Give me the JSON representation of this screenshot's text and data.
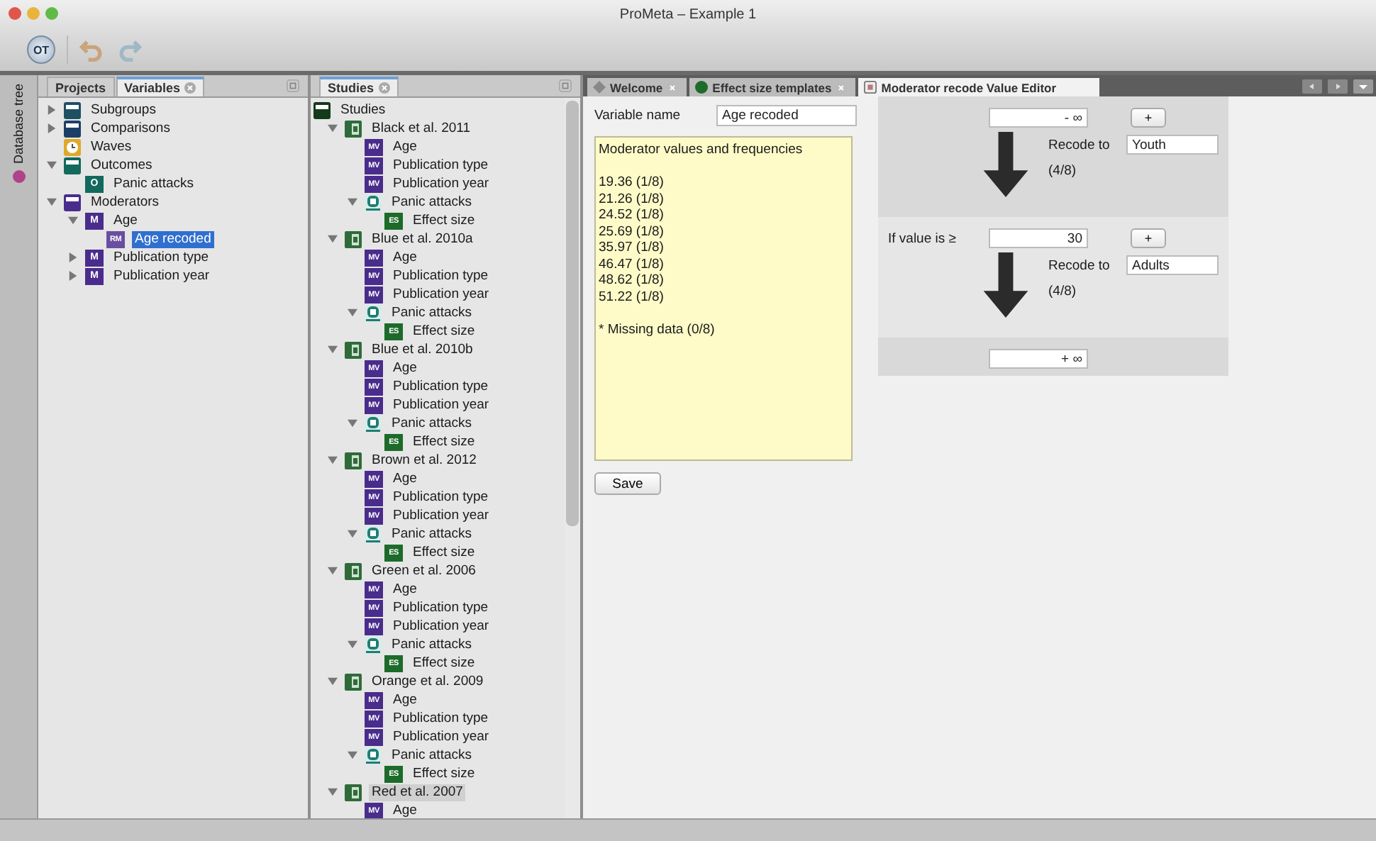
{
  "window": {
    "title": "ProMeta – Example 1"
  },
  "toolbar": {
    "logo": "OT"
  },
  "side_tab": {
    "label": "Database tree"
  },
  "variables_panel": {
    "tabs": [
      {
        "label": "Projects",
        "selected": false,
        "closable": false
      },
      {
        "label": "Variables",
        "selected": true,
        "closable": true
      }
    ],
    "items": [
      {
        "label": "Subgroups",
        "kind": "folder",
        "color": "#1f4f63",
        "expanded": false,
        "selected": false
      },
      {
        "label": "Comparisons",
        "kind": "folder",
        "color": "#1d3f66",
        "expanded": false,
        "selected": false
      },
      {
        "label": "Waves",
        "kind": "clock",
        "selected": false
      },
      {
        "label": "Outcomes",
        "kind": "folder",
        "color": "#12695c",
        "expanded": true,
        "selected": false,
        "children": [
          {
            "label": "Panic attacks",
            "kind": "badge",
            "badge": "O",
            "color": "#12695c",
            "selected": false
          }
        ]
      },
      {
        "label": "Moderators",
        "kind": "folder",
        "color": "#4a2c8c",
        "expanded": true,
        "selected": false,
        "children": [
          {
            "label": "Age",
            "kind": "badge",
            "badge": "M",
            "color": "#4a2c8c",
            "expanded": true,
            "selected": false,
            "children": [
              {
                "label": "Age recoded",
                "kind": "badge",
                "badge": "RM",
                "color": "#6a4fa0",
                "selected": true
              }
            ]
          },
          {
            "label": "Publication type",
            "kind": "badge",
            "badge": "M",
            "color": "#4a2c8c",
            "expanded": false,
            "selected": false
          },
          {
            "label": "Publication year",
            "kind": "badge",
            "badge": "M",
            "color": "#4a2c8c",
            "expanded": false,
            "selected": false
          }
        ]
      }
    ]
  },
  "studies_panel": {
    "tabs": [
      {
        "label": "Studies",
        "selected": true,
        "closable": true
      }
    ],
    "items": [
      {
        "label": "Studies",
        "kind": "root",
        "selected": false,
        "children": [
          {
            "label": "Black et al. 2011",
            "kind": "study",
            "expanded": true,
            "selected": false,
            "children": [
              {
                "label": "Age",
                "kind": "badge",
                "badge": "MV",
                "color": "#4a2c8c",
                "selected": false
              },
              {
                "label": "Publication type",
                "kind": "badge",
                "badge": "MV",
                "color": "#4a2c8c",
                "selected": false
              },
              {
                "label": "Publication year",
                "kind": "badge",
                "badge": "MV",
                "color": "#4a2c8c",
                "selected": false
              },
              {
                "label": "Panic attacks",
                "kind": "outcome",
                "expanded": true,
                "selected": false,
                "children": [
                  {
                    "label": "Effect size",
                    "kind": "badge",
                    "badge": "ES",
                    "color": "#1d6b2a",
                    "selected": false
                  }
                ]
              }
            ]
          },
          {
            "label": "Blue et al. 2010a",
            "kind": "study",
            "expanded": true,
            "selected": false,
            "children": [
              {
                "label": "Age",
                "kind": "badge",
                "badge": "MV",
                "color": "#4a2c8c",
                "selected": false
              },
              {
                "label": "Publication type",
                "kind": "badge",
                "badge": "MV",
                "color": "#4a2c8c",
                "selected": false
              },
              {
                "label": "Publication year",
                "kind": "badge",
                "badge": "MV",
                "color": "#4a2c8c",
                "selected": false
              },
              {
                "label": "Panic attacks",
                "kind": "outcome",
                "expanded": true,
                "selected": false,
                "children": [
                  {
                    "label": "Effect size",
                    "kind": "badge",
                    "badge": "ES",
                    "color": "#1d6b2a",
                    "selected": false
                  }
                ]
              }
            ]
          },
          {
            "label": "Blue et al. 2010b",
            "kind": "study",
            "expanded": true,
            "selected": false,
            "children": [
              {
                "label": "Age",
                "kind": "badge",
                "badge": "MV",
                "color": "#4a2c8c",
                "selected": false
              },
              {
                "label": "Publication type",
                "kind": "badge",
                "badge": "MV",
                "color": "#4a2c8c",
                "selected": false
              },
              {
                "label": "Publication year",
                "kind": "badge",
                "badge": "MV",
                "color": "#4a2c8c",
                "selected": false
              },
              {
                "label": "Panic attacks",
                "kind": "outcome",
                "expanded": true,
                "selected": false,
                "children": [
                  {
                    "label": "Effect size",
                    "kind": "badge",
                    "badge": "ES",
                    "color": "#1d6b2a",
                    "selected": false
                  }
                ]
              }
            ]
          },
          {
            "label": "Brown et al. 2012",
            "kind": "study",
            "expanded": true,
            "selected": false,
            "children": [
              {
                "label": "Age",
                "kind": "badge",
                "badge": "MV",
                "color": "#4a2c8c",
                "selected": false
              },
              {
                "label": "Publication type",
                "kind": "badge",
                "badge": "MV",
                "color": "#4a2c8c",
                "selected": false
              },
              {
                "label": "Publication year",
                "kind": "badge",
                "badge": "MV",
                "color": "#4a2c8c",
                "selected": false
              },
              {
                "label": "Panic attacks",
                "kind": "outcome",
                "expanded": true,
                "selected": false,
                "children": [
                  {
                    "label": "Effect size",
                    "kind": "badge",
                    "badge": "ES",
                    "color": "#1d6b2a",
                    "selected": false
                  }
                ]
              }
            ]
          },
          {
            "label": "Green et al. 2006",
            "kind": "study",
            "expanded": true,
            "selected": false,
            "children": [
              {
                "label": "Age",
                "kind": "badge",
                "badge": "MV",
                "color": "#4a2c8c",
                "selected": false
              },
              {
                "label": "Publication type",
                "kind": "badge",
                "badge": "MV",
                "color": "#4a2c8c",
                "selected": false
              },
              {
                "label": "Publication year",
                "kind": "badge",
                "badge": "MV",
                "color": "#4a2c8c",
                "selected": false
              },
              {
                "label": "Panic attacks",
                "kind": "outcome",
                "expanded": true,
                "selected": false,
                "children": [
                  {
                    "label": "Effect size",
                    "kind": "badge",
                    "badge": "ES",
                    "color": "#1d6b2a",
                    "selected": false
                  }
                ]
              }
            ]
          },
          {
            "label": "Orange et al. 2009",
            "kind": "study",
            "expanded": true,
            "selected": false,
            "children": [
              {
                "label": "Age",
                "kind": "badge",
                "badge": "MV",
                "color": "#4a2c8c",
                "selected": false
              },
              {
                "label": "Publication type",
                "kind": "badge",
                "badge": "MV",
                "color": "#4a2c8c",
                "selected": false
              },
              {
                "label": "Publication year",
                "kind": "badge",
                "badge": "MV",
                "color": "#4a2c8c",
                "selected": false
              },
              {
                "label": "Panic attacks",
                "kind": "outcome",
                "expanded": true,
                "selected": false,
                "children": [
                  {
                    "label": "Effect size",
                    "kind": "badge",
                    "badge": "ES",
                    "color": "#1d6b2a",
                    "selected": false
                  }
                ]
              }
            ]
          },
          {
            "label": "Red et al. 2007",
            "kind": "study",
            "expanded": true,
            "selected": true,
            "children": [
              {
                "label": "Age",
                "kind": "badge",
                "badge": "MV",
                "color": "#4a2c8c",
                "selected": false
              }
            ]
          }
        ]
      }
    ]
  },
  "editor": {
    "tabs": [
      {
        "label": "Welcome",
        "kind": "diamond",
        "selected": false,
        "closable": true
      },
      {
        "label": "Effect size templates",
        "kind": "circle",
        "selected": false,
        "closable": true
      },
      {
        "label": "Moderator recode Value Editor",
        "kind": "doc",
        "selected": true,
        "closable": false
      }
    ],
    "variable_name": {
      "label": "Variable name",
      "value": "Age recoded"
    },
    "frequencies": {
      "title": "Moderator values and frequencies",
      "values": [
        "19.36 (1/8)",
        "21.26 (1/8)",
        "24.52 (1/8)",
        "25.69 (1/8)",
        "35.97 (1/8)",
        "46.47 (1/8)",
        "48.62 (1/8)",
        "51.22 (1/8)"
      ],
      "missing": "* Missing data (0/8)"
    },
    "save_button": "Save",
    "recode": {
      "sections": [
        {
          "bound": {
            "value": "- ∞",
            "add": "+"
          },
          "range": {
            "label": "Recode to",
            "value": "Youth",
            "count": "(4/8)"
          }
        },
        {
          "bound": {
            "label": "If value is ≥",
            "value": "30",
            "add": "+"
          },
          "range": {
            "label": "Recode to",
            "value": "Adults",
            "count": "(4/8)"
          }
        },
        {
          "bound": {
            "value": "+ ∞"
          }
        }
      ]
    }
  }
}
